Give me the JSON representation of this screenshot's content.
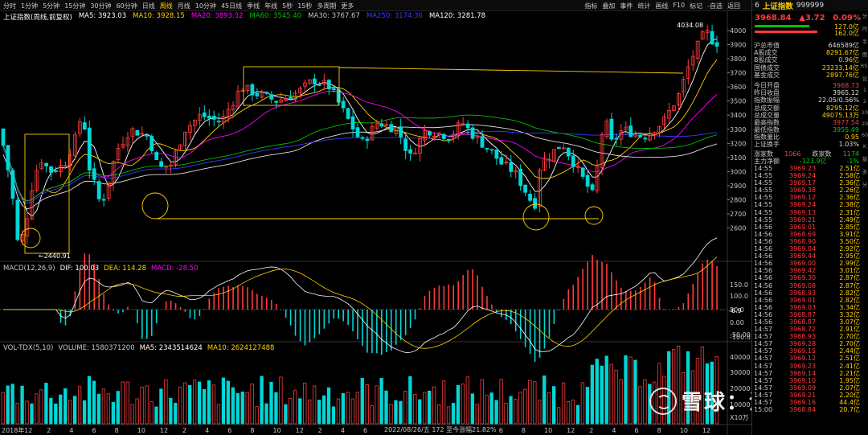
{
  "toolbar": {
    "periods": [
      "分时",
      "1分钟",
      "5分钟",
      "15分钟",
      "30分钟",
      "60分钟",
      "日线",
      "周线",
      "月线",
      "10分钟",
      "45日线",
      "季线",
      "年线",
      "5秒",
      "15秒",
      "多周期",
      "更多"
    ],
    "active_period": "周线",
    "right_menu": [
      "指标",
      "叠加",
      "事件",
      "统计",
      "画线",
      "F10",
      "标记",
      "-自选",
      "返回"
    ]
  },
  "main_legend": {
    "title": "上证指数(周线,前复权)",
    "items": [
      {
        "text": "MA5: 3923.03",
        "color": "#ffffff"
      },
      {
        "text": "MA10: 3928.15",
        "color": "#ffd000"
      },
      {
        "text": "MA20: 3893.32",
        "color": "#ff00ff"
      },
      {
        "text": "MA60: 3545.40",
        "color": "#00c000"
      },
      {
        "text": "MA30: 3767.67",
        "color": "#c8c8c8"
      },
      {
        "text": "MA250: 3174.36",
        "color": "#3b3bff"
      },
      {
        "text": "MA120: 3281.78",
        "color": "#ffffff"
      }
    ]
  },
  "price_axis": [
    "4000",
    "3900",
    "3800",
    "3700",
    "3600",
    "3500",
    "3400",
    "3300",
    "3200",
    "3100",
    "3000",
    "2900",
    "2800",
    "2700",
    "2600"
  ],
  "annotations": {
    "high": "4034.08",
    "low": "2440.91"
  },
  "macd_legend": {
    "name": "MACD(12,26,9)",
    "dif": "DIF: 100.03",
    "dea": "DEA: 114.28",
    "macd": "MACD: -28.50"
  },
  "macd_axis": [
    "150.0",
    "100.0",
    "50.0",
    "0.00",
    "-50.00",
    "-100.0"
  ],
  "macd_current": "-6.9",
  "vol_legend": {
    "name": "VOL-TDX(5,10)",
    "volume": "VOLUME: 1580371200",
    "ma5": "MA5: 2343514624",
    "ma10": "MA10: 2624127488"
  },
  "vol_axis": [
    "40000",
    "30000",
    "20000",
    "10000"
  ],
  "vol_unit": "X10万",
  "x_axis": [
    "2018年",
    "12",
    "2",
    "4",
    "6",
    "8",
    "10",
    "12",
    "2",
    "4",
    "6",
    "8",
    "10",
    "12",
    "2",
    "4",
    "6",
    "8",
    "10",
    "12",
    "2",
    "4",
    "6",
    "8",
    "10",
    "12",
    "2",
    "4",
    "6",
    "8",
    "10",
    "12"
  ],
  "bottom_label": "2022/08/26/五 172 至今涨幅21.82%",
  "watermark": "雪球：滇南王",
  "side_icons": [
    "分",
    "时",
    "手",
    "图",
    "RSI",
    "论",
    "1",
    "2",
    "10",
    "20",
    "60",
    "K",
    "基",
    "多",
    "分"
  ],
  "right_panel": {
    "index_code": "6",
    "index_name": "上证指数",
    "index_num": "999999",
    "price": "3968.84",
    "change": "▲3.72",
    "change_pct": "0.09%",
    "bar_values": [
      "127.0亿",
      "162.0亿"
    ],
    "stats": [
      {
        "k": "沪总市值",
        "v": "646589亿",
        "c": "w"
      },
      {
        "k": "A股成交",
        "v": "8291.67亿",
        "c": "y"
      },
      {
        "k": "B股成交",
        "v": "0.96亿",
        "c": "y"
      },
      {
        "k": "国债成交",
        "v": "23233.14亿",
        "c": "y"
      },
      {
        "k": "基金成交",
        "v": "2897.76亿",
        "c": "y"
      },
      {
        "k": "今日开盘",
        "v": "3968.73",
        "c": "r"
      },
      {
        "k": "昨日收盘",
        "v": "3965.12",
        "c": "w"
      },
      {
        "k": "指数振幅",
        "v": "22.05/0.56%",
        "c": "w"
      },
      {
        "k": "总成交额",
        "v": "8295.12亿",
        "c": "y"
      },
      {
        "k": "总成交量",
        "v": "49075.13万",
        "c": "y"
      },
      {
        "k": "最高指数",
        "v": "3977.54",
        "c": "r"
      },
      {
        "k": "最低指数",
        "v": "3955.49",
        "c": "g"
      },
      {
        "k": "指数量比",
        "v": "0.95",
        "c": "y"
      },
      {
        "k": "上证换手",
        "v": "1.03%",
        "c": "w"
      }
    ],
    "breadth": {
      "up_label": "涨家数",
      "up": "1066",
      "down_label": "跌家数",
      "down": "1174"
    },
    "net_label": "主力净额",
    "net_value": "-123.9亿",
    "net_pct": "-1%",
    "ticks": [
      {
        "t": "14:55",
        "p": "3969.23",
        "v": "2.51亿"
      },
      {
        "t": "14:55",
        "p": "3969.24",
        "v": "2.58亿"
      },
      {
        "t": "14:55",
        "p": "3969.17",
        "v": "2.36亿"
      },
      {
        "t": "14:55",
        "p": "3969.38",
        "v": "2.26亿"
      },
      {
        "t": "14:55",
        "p": "3969.12",
        "v": "2.36亿"
      },
      {
        "t": "14:55",
        "p": "3969.24",
        "v": "2.38亿"
      },
      {
        "t": "14:55",
        "p": "3969.13",
        "v": "2.31亿"
      },
      {
        "t": "14:55",
        "p": "3969.21",
        "v": "2.49亿"
      },
      {
        "t": "14:56",
        "p": "3969.01",
        "v": "2.85亿"
      },
      {
        "t": "14:56",
        "p": "3968.69",
        "v": "3.91亿"
      },
      {
        "t": "14:56",
        "p": "3968.90",
        "v": "3.50亿"
      },
      {
        "t": "14:56",
        "p": "3969.04",
        "v": "2.92亿"
      },
      {
        "t": "14:56",
        "p": "3969.44",
        "v": "2.95亿"
      },
      {
        "t": "14:56",
        "p": "3969.00",
        "v": "2.99亿"
      },
      {
        "t": "14:56",
        "p": "3969.42",
        "v": "3.01亿"
      },
      {
        "t": "14:56",
        "p": "3969.30",
        "v": "2.87亿"
      },
      {
        "t": "14:56",
        "p": "3969.08",
        "v": "2.87亿"
      },
      {
        "t": "14:56",
        "p": "3968.93",
        "v": "2.82亿"
      },
      {
        "t": "14:56",
        "p": "3969.01",
        "v": "2.82亿"
      },
      {
        "t": "14:56",
        "p": "3969.03",
        "v": "3.34亿"
      },
      {
        "t": "14:56",
        "p": "3968.87",
        "v": "3.32亿"
      },
      {
        "t": "14:56",
        "p": "3968.87",
        "v": "3.07亿"
      },
      {
        "t": "14:57",
        "p": "3968.72",
        "v": "2.91亿"
      },
      {
        "t": "14:57",
        "p": "3968.93",
        "v": "2.70亿"
      },
      {
        "t": "14:57",
        "p": "3969.28",
        "v": "2.70亿"
      },
      {
        "t": "14:57",
        "p": "3969.15",
        "v": "2.44亿"
      },
      {
        "t": "14:57",
        "p": "3969.12",
        "v": "2.51亿"
      },
      {
        "t": "14:57",
        "p": "3969.23",
        "v": "2.41亿"
      },
      {
        "t": "14:57",
        "p": "3969.14",
        "v": "2.21亿"
      },
      {
        "t": "14:57",
        "p": "3969.10",
        "v": "1.95亿"
      },
      {
        "t": "14:57",
        "p": "3969.09",
        "v": "2.07亿"
      },
      {
        "t": "14:57",
        "p": "3969.21",
        "v": "2.20亿"
      },
      {
        "t": "14:57",
        "p": "3969.16",
        "v": "44.4亿"
      },
      {
        "t": "15:00",
        "p": "3968.84",
        "v": "20.7亿"
      }
    ]
  },
  "chart_data": {
    "type": "candlestick",
    "title": "上证指数(周线,前复权)",
    "ylim": [
      2440.91,
      4034.08
    ],
    "y_ticks": [
      4000,
      3900,
      3800,
      3700,
      3600,
      3500,
      3400,
      3300,
      3200,
      3100,
      3000,
      2900,
      2800,
      2700,
      2600
    ],
    "annotations": [
      {
        "label": "4034.08"
      },
      {
        "label": "2440.91"
      }
    ]
  }
}
